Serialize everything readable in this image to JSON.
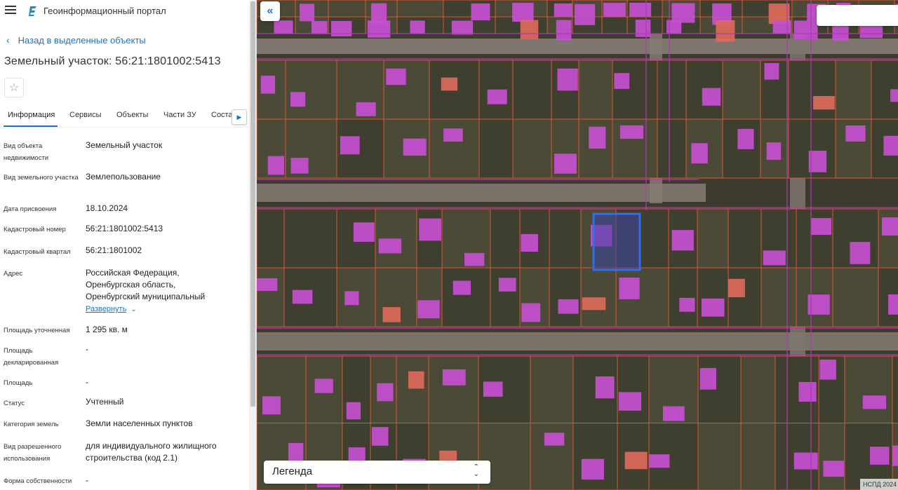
{
  "header": {
    "menu_icon": "hamburger-icon",
    "logo_icon": "portal-logo-icon",
    "portal_title": "Геоинформационный портал"
  },
  "navigation": {
    "back_label": "Назад в выделенные объекты",
    "back_icon": "chevron-left-icon"
  },
  "object": {
    "title": "Земельный участок: 56:21:1801002:5413",
    "favorite_icon": "star-icon"
  },
  "tabs": [
    {
      "label": "Информация",
      "active": true
    },
    {
      "label": "Сервисы",
      "active": false
    },
    {
      "label": "Объекты",
      "active": false
    },
    {
      "label": "Части ЗУ",
      "active": false
    },
    {
      "label": "Соста",
      "active": false
    }
  ],
  "tabs_next_icon": "chevron-right-icon",
  "properties": [
    {
      "label": "Вид объекта недвижимости",
      "value": "Земельный участок"
    },
    {
      "label": "Вид земельного участка",
      "value": "Землепользование"
    },
    {
      "label": "Дата присвоения",
      "value": "18.10.2024"
    },
    {
      "label": "Кадастровый номер",
      "value": "56:21:1801002:5413"
    },
    {
      "label": "Кадастровый квартал",
      "value": "56:21:1801002"
    },
    {
      "label": "Адрес",
      "value": "Российская Федерация, Оренбургская область, Оренбургский муниципальный"
    },
    {
      "label": "Площадь уточненная",
      "value": "1 295 кв. м"
    },
    {
      "label": "Площадь декларированная",
      "value": "-"
    },
    {
      "label": "Площадь",
      "value": "-"
    },
    {
      "label": "Статус",
      "value": "Учтенный"
    },
    {
      "label": "Категория земель",
      "value": "Земли населенных пунктов"
    },
    {
      "label": "Вид разрешенного использования",
      "value": "для индивидуального жилищного строительства (код 2.1)"
    },
    {
      "label": "Форма собственности",
      "value": "-"
    }
  ],
  "address_expand_label": "Развернуть",
  "map": {
    "collapse_icon": "double-chevron-left-icon",
    "legend_label": "Легенда",
    "legend_icon": "up-down-chevron-icon",
    "copyright": "НСПД 2024",
    "colors": {
      "parcel_border": "#d9553a",
      "building": "#c94fd6",
      "selected": "#2f6fe8",
      "road": "#8a7f7a",
      "quarter_border": "#b03ab5"
    }
  }
}
